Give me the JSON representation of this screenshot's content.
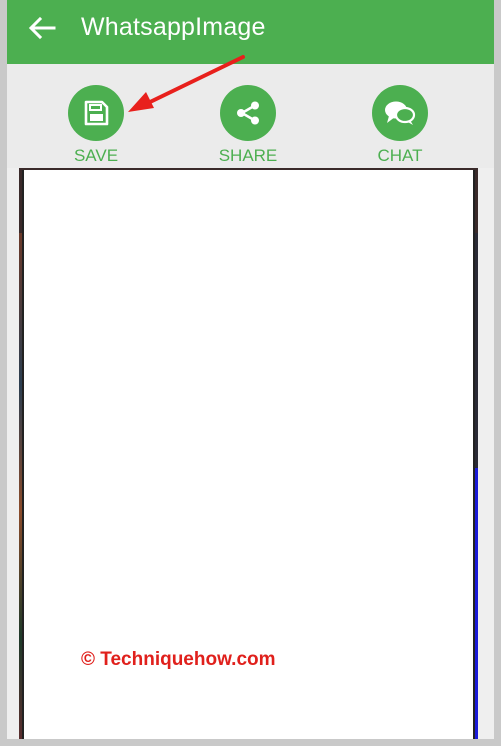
{
  "appbar": {
    "title": "WhatsappImage",
    "back_icon": "arrow-left-icon"
  },
  "actions": [
    {
      "label": "SAVE",
      "icon": "floppy-disk-icon"
    },
    {
      "label": "SHARE",
      "icon": "share-icon"
    },
    {
      "label": "CHAT",
      "icon": "chat-bubbles-icon"
    }
  ],
  "watermark": "© Techniquehow.com",
  "colors": {
    "primary": "#4caf50",
    "annotation_arrow": "#e8201c",
    "watermark": "#e0201c"
  }
}
